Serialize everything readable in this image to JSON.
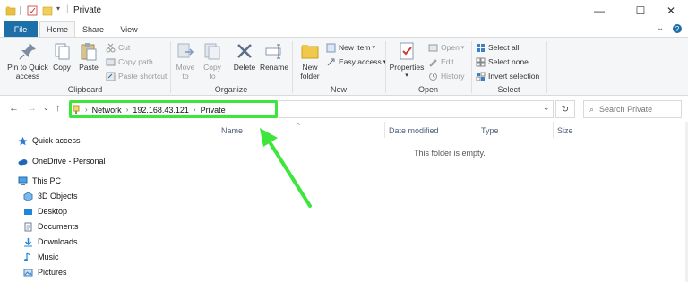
{
  "window": {
    "title": "Private",
    "minimize": "—",
    "maximize": "☐",
    "close": "✕"
  },
  "ribbon_tabs": [
    "File",
    "Home",
    "Share",
    "View"
  ],
  "ribbon": {
    "clipboard": {
      "label": "Clipboard",
      "pin": "Pin to Quick access",
      "copy": "Copy",
      "paste": "Paste",
      "cut": "Cut",
      "copy_path": "Copy path",
      "paste_shortcut": "Paste shortcut"
    },
    "organize": {
      "label": "Organize",
      "move_to": "Move to",
      "copy_to": "Copy to",
      "delete": "Delete",
      "rename": "Rename"
    },
    "new": {
      "label": "New",
      "new_folder": "New folder",
      "new_item": "New item",
      "easy_access": "Easy access"
    },
    "open": {
      "label": "Open",
      "properties": "Properties",
      "open": "Open",
      "edit": "Edit",
      "history": "History"
    },
    "select": {
      "label": "Select",
      "select_all": "Select all",
      "select_none": "Select none",
      "invert": "Invert selection"
    }
  },
  "address": {
    "crumbs": [
      "Network",
      "192.168.43.121",
      "Private"
    ],
    "search_placeholder": "Search Private"
  },
  "navpane": {
    "quick_access": "Quick access",
    "onedrive": "OneDrive - Personal",
    "this_pc": "This PC",
    "items": [
      "3D Objects",
      "Desktop",
      "Documents",
      "Downloads",
      "Music",
      "Pictures"
    ]
  },
  "columns": [
    "Name",
    "Date modified",
    "Type",
    "Size"
  ],
  "empty_message": "This folder is empty.",
  "colors": {
    "accent": "#1c6fa9",
    "highlight": "#3ee63c"
  }
}
